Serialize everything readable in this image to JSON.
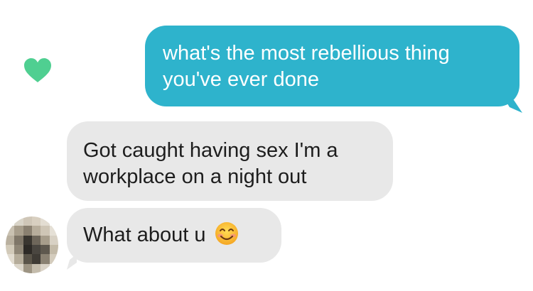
{
  "messages": [
    {
      "direction": "sent",
      "lines": [
        "what's the most rebellious thing",
        "you've ever done"
      ]
    },
    {
      "direction": "received",
      "lines": [
        "Got caught having sex I'm a",
        "workplace on a night out"
      ]
    },
    {
      "direction": "received",
      "text": "What about u",
      "emoji": "smiling-face-emoji"
    }
  ],
  "colors": {
    "sent_bubble": "#2eb3cc",
    "received_bubble": "#e8e8e8",
    "like_heart": "#4fcf91"
  },
  "avatar": {
    "state": "blurred-pixelated"
  }
}
